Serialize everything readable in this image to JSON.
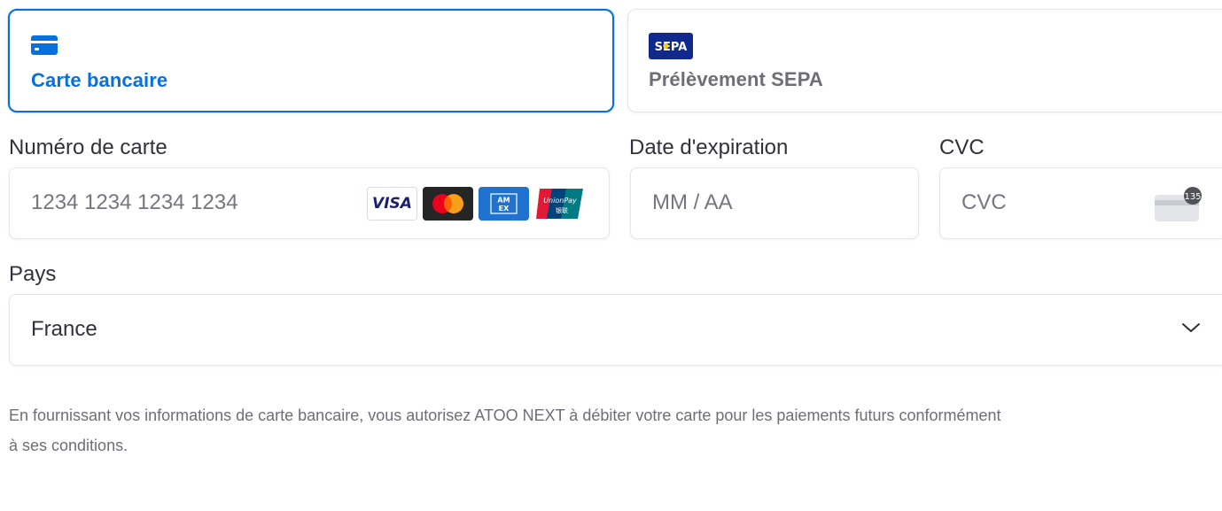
{
  "tabs": [
    {
      "label": "Carte bancaire",
      "icon": "card-icon",
      "selected": true
    },
    {
      "label": "Prélèvement SEPA",
      "icon": "sepa-icon",
      "icon_text": "SEPA",
      "selected": false
    }
  ],
  "card_number": {
    "label": "Numéro de carte",
    "placeholder": "1234 1234 1234 1234",
    "brands": [
      "VISA",
      "Mastercard",
      "AMEX",
      "UnionPay"
    ],
    "visa_text": "VISA",
    "amex_text": "AMERICAN EXPRESS",
    "unionpay_text": "UnionPay"
  },
  "expiry": {
    "label": "Date d'expiration",
    "placeholder": "MM / AA"
  },
  "cvc": {
    "label": "CVC",
    "placeholder": "CVC",
    "icon_badge": "135"
  },
  "country": {
    "label": "Pays",
    "value": "France"
  },
  "notice": {
    "line1": "En fournissant vos informations de carte bancaire, vous autorisez ATOO NEXT à débiter votre carte pour les paiements futurs conformément",
    "line2": "à ses conditions."
  },
  "colors": {
    "accent": "#0570de",
    "text": "#30313d",
    "muted": "#6d6e78",
    "placeholder": "#75767f",
    "border": "#e6e6e6"
  }
}
